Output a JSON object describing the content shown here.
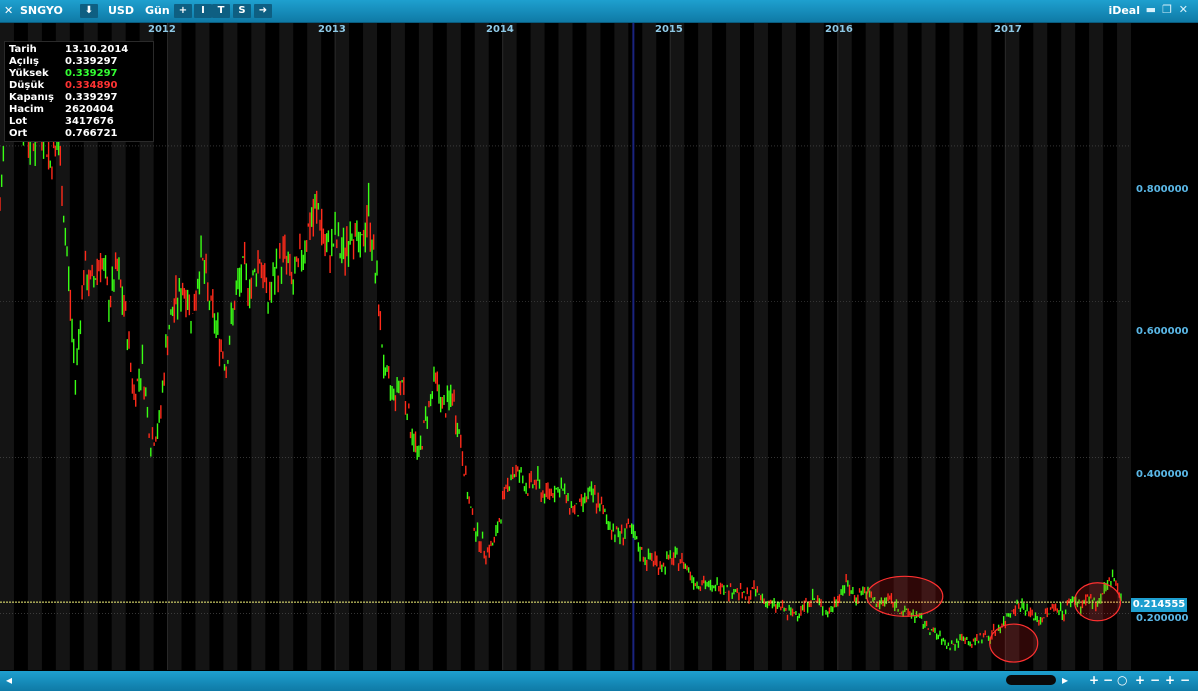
{
  "toolbar": {
    "symbol": "SNGYO",
    "currency": "USD",
    "period": "Gün",
    "brand": "iDeal",
    "buttons": [
      "+",
      "I",
      "T",
      "S"
    ]
  },
  "info_box": {
    "rows": [
      {
        "label": "Tarih",
        "value": "13.10.2014",
        "color": "#ffffff"
      },
      {
        "label": "Açılış",
        "value": "0.339297",
        "color": "#ffffff"
      },
      {
        "label": "Yüksek",
        "value": "0.339297",
        "color": "#33ff33"
      },
      {
        "label": "Düşük",
        "value": "0.334890",
        "color": "#ff3333"
      },
      {
        "label": "Kapanış",
        "value": "0.339297",
        "color": "#ffffff"
      },
      {
        "label": "Hacim",
        "value": "2620404",
        "color": "#ffffff"
      },
      {
        "label": "Lot",
        "value": "3417676",
        "color": "#ffffff"
      },
      {
        "label": "Ort",
        "value": "0.766721",
        "color": "#ffffff"
      }
    ]
  },
  "current_price": "0.214555",
  "chart_data": {
    "type": "line",
    "title": "",
    "xlabel": "",
    "ylabel": "",
    "x_ticks": [
      "2012",
      "2013",
      "2014",
      "2015",
      "2016",
      "2017"
    ],
    "y_ticks": [
      "0.800000",
      "0.600000",
      "0.400000",
      "0.200000"
    ],
    "ylim": [
      0.13,
      0.95
    ],
    "grid": true,
    "colors": {
      "up": "#39ff14",
      "down": "#ff2a1a",
      "price_line": "#f4f47a",
      "highlight": "#ff3030"
    },
    "series": [
      {
        "x": [
          2011.0,
          2011.05,
          2011.1,
          2011.15,
          2011.2,
          2011.25,
          2011.3,
          2011.35,
          2011.4,
          2011.45,
          2011.5,
          2011.55,
          2011.6,
          2011.65,
          2011.7,
          2011.75,
          2011.8,
          2011.85,
          2011.9,
          2011.95,
          2012.0,
          2012.05,
          2012.1,
          2012.15,
          2012.2,
          2012.25,
          2012.3,
          2012.35,
          2012.4,
          2012.45,
          2012.5,
          2012.55,
          2012.6,
          2012.65,
          2012.7,
          2012.75,
          2012.8,
          2012.85,
          2012.9,
          2012.95,
          2013.0,
          2013.05,
          2013.1,
          2013.15,
          2013.2,
          2013.25,
          2013.3,
          2013.35,
          2013.4,
          2013.45,
          2013.5,
          2013.55,
          2013.6,
          2013.65,
          2013.7,
          2013.75,
          2013.8,
          2013.85,
          2013.9,
          2013.95,
          2014.0,
          2014.05,
          2014.1,
          2014.15,
          2014.2,
          2014.25,
          2014.3,
          2014.35,
          2014.4,
          2014.45,
          2014.5,
          2014.55,
          2014.6,
          2014.65,
          2014.7,
          2014.75,
          2014.8,
          2014.85,
          2014.9,
          2014.95,
          2015.0,
          2015.05,
          2015.1,
          2015.15,
          2015.2,
          2015.25,
          2015.3,
          2015.35,
          2015.4,
          2015.45,
          2015.5,
          2015.55,
          2015.6,
          2015.65,
          2015.7,
          2015.75,
          2015.8,
          2015.85,
          2015.9,
          2015.95,
          2016.0,
          2016.05,
          2016.1,
          2016.15,
          2016.2,
          2016.25,
          2016.3,
          2016.35,
          2016.4,
          2016.45,
          2016.5,
          2016.55,
          2016.6,
          2016.65,
          2016.7,
          2016.75,
          2016.8,
          2016.85,
          2016.9,
          2016.95,
          2017.0,
          2017.05,
          2017.1,
          2017.15,
          2017.2,
          2017.25,
          2017.3,
          2017.35,
          2017.4,
          2017.45,
          2017.5,
          2017.55,
          2017.6,
          2017.65,
          2017.7
        ],
        "y": [
          0.72,
          0.88,
          0.9,
          0.83,
          0.8,
          0.84,
          0.78,
          0.8,
          0.66,
          0.5,
          0.64,
          0.62,
          0.66,
          0.6,
          0.64,
          0.58,
          0.48,
          0.52,
          0.42,
          0.44,
          0.56,
          0.6,
          0.62,
          0.58,
          0.66,
          0.6,
          0.56,
          0.52,
          0.6,
          0.64,
          0.62,
          0.66,
          0.6,
          0.64,
          0.66,
          0.62,
          0.66,
          0.7,
          0.72,
          0.66,
          0.68,
          0.66,
          0.7,
          0.66,
          0.72,
          0.62,
          0.5,
          0.48,
          0.5,
          0.44,
          0.4,
          0.46,
          0.5,
          0.46,
          0.48,
          0.42,
          0.34,
          0.3,
          0.28,
          0.29,
          0.34,
          0.38,
          0.38,
          0.36,
          0.37,
          0.35,
          0.36,
          0.36,
          0.34,
          0.33,
          0.35,
          0.35,
          0.33,
          0.31,
          0.3,
          0.31,
          0.29,
          0.27,
          0.27,
          0.26,
          0.27,
          0.27,
          0.26,
          0.24,
          0.24,
          0.23,
          0.24,
          0.23,
          0.23,
          0.22,
          0.23,
          0.22,
          0.21,
          0.21,
          0.2,
          0.2,
          0.21,
          0.22,
          0.21,
          0.2,
          0.22,
          0.24,
          0.22,
          0.23,
          0.22,
          0.21,
          0.22,
          0.21,
          0.2,
          0.2,
          0.19,
          0.18,
          0.17,
          0.16,
          0.16,
          0.17,
          0.16,
          0.17,
          0.17,
          0.18,
          0.19,
          0.21,
          0.21,
          0.2,
          0.19,
          0.2,
          0.21,
          0.2,
          0.22,
          0.21,
          0.22,
          0.21,
          0.23,
          0.25,
          0.215
        ]
      }
    ]
  }
}
